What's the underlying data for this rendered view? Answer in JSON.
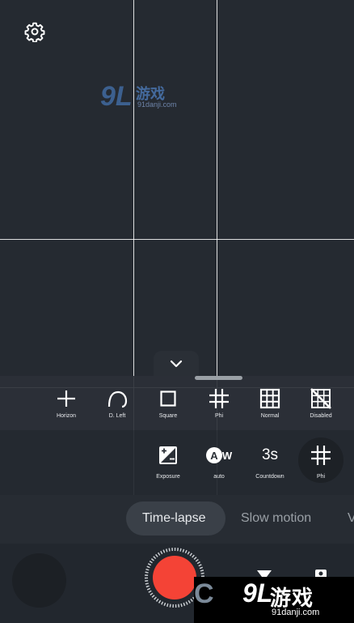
{
  "watermark_top": {
    "logo": "9L",
    "cn": "游戏",
    "url": "91danji.com"
  },
  "watermark_bottom": {
    "letter": "C",
    "logo": "9L",
    "cn": "游戏",
    "url": "91danji.com"
  },
  "grid_options": [
    {
      "label": "Horizon",
      "icon": "plus-icon"
    },
    {
      "label": "D. Left",
      "icon": "spiral-icon"
    },
    {
      "label": "Square",
      "icon": "square-icon"
    },
    {
      "label": "Phi",
      "icon": "grid-hash-icon"
    },
    {
      "label": "Normal",
      "icon": "grid-3x3-icon"
    },
    {
      "label": "Disabled",
      "icon": "grid-off-icon"
    }
  ],
  "camera_settings": [
    {
      "label": "Exposure",
      "icon": "exposure-icon"
    },
    {
      "label": "auto",
      "icon": "white-balance-auto-icon",
      "icon_text": "AW"
    },
    {
      "label": "Countdown",
      "icon": "countdown-icon",
      "icon_text": "3s"
    },
    {
      "label": "Phi",
      "icon": "grid-hash-icon",
      "selected": true
    }
  ],
  "modes": {
    "active": "Time-lapse",
    "inactive": "Slow motion",
    "edge": "V"
  },
  "colors": {
    "background": "#22272e",
    "shutter": "#f44336",
    "grid_line": "#ffffff",
    "pill": "#3a4048"
  }
}
